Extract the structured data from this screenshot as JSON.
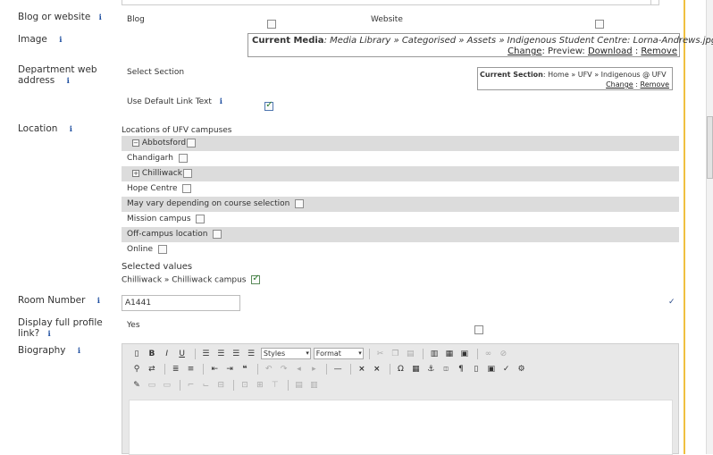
{
  "blog": {
    "label": "Blog or website",
    "option_blog": "Blog",
    "option_website": "Website"
  },
  "image": {
    "label": "Image",
    "current_media_label": "Current Media",
    "path": ": Media Library » Categorised » Assets » Indigenous Student Centre: Lorna-Andrews.jpg",
    "change": "Change",
    "preview_label": ": Preview: ",
    "download": "Download",
    "sep": ":",
    "remove": "Remove"
  },
  "department": {
    "label_line1": "Department web",
    "label_line2": "address",
    "select_section": "Select Section",
    "current_section_label": "Current Section",
    "current_section_value": ": Home » UFV » Indigenous @ UFV",
    "change": "Change",
    "sep": ":",
    "remove": "Remove",
    "use_default_link_text": "Use Default Link Text",
    "use_default_checked": true
  },
  "location": {
    "label": "Location",
    "title": "Locations of UFV campuses",
    "options": [
      {
        "text": "Abbotsford",
        "expandable": true
      },
      {
        "text": "Chandigarh",
        "expandable": false
      },
      {
        "text": "Chilliwack",
        "expandable": true
      },
      {
        "text": "Hope Centre",
        "expandable": false
      },
      {
        "text": "May vary depending on course selection",
        "expandable": false
      },
      {
        "text": "Mission campus",
        "expandable": false
      },
      {
        "text": "Off-campus location",
        "expandable": false
      },
      {
        "text": "Online",
        "expandable": false
      }
    ],
    "selected_values_label": "Selected values",
    "selected_value": "Chilliwack » Chilliwack campus"
  },
  "room": {
    "label": "Room Number",
    "value": "A1441"
  },
  "display_profile": {
    "label_line1": "Display full profile",
    "label_line2": "link?",
    "option_yes": "Yes"
  },
  "biography": {
    "label": "Biography",
    "styles_combo": "Styles",
    "format_combo": "Format"
  },
  "info_glyph": "i"
}
